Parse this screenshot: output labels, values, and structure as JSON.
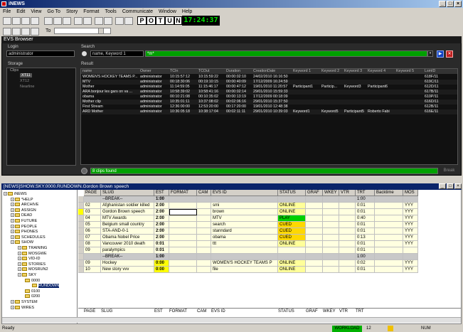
{
  "window": {
    "title": "iNEWS",
    "minimize": "_",
    "maximize": "□",
    "close": "×"
  },
  "menu": [
    "File",
    "Edit",
    "View",
    "Go To",
    "Story",
    "Format",
    "Tools",
    "Communicate",
    "Window",
    "Help"
  ],
  "toolbar": {
    "letters": [
      "P",
      "O",
      "T",
      "U",
      "N"
    ],
    "clock": "17:24:37",
    "to_label": "To"
  },
  "evs": {
    "title": "EVS Browser",
    "login_label": "Login",
    "login_value": "administrator",
    "search_label": "Search",
    "search_placeholder": "name, Keyword 1",
    "search_query": "*m*",
    "storage_label": "Storage",
    "storage_items": [
      "Clips",
      "XT11",
      "XT12",
      "Nearline"
    ],
    "result_label": "Result",
    "status": "8 clips found",
    "break_label": "Break",
    "columns": [
      "name",
      "Owner",
      "TCIn",
      "TCOut",
      "Duration",
      "CreationDate",
      "Keyword 1",
      "Keyword 2",
      "Keyword 3",
      "Keyword 4",
      "Keyword 5",
      "LsmID"
    ],
    "rows": [
      [
        "WOMEN'S HOCKEY TEAMS P...",
        "administrator",
        "10:15:57:12",
        "10:15:59:22",
        "00:00:02:10",
        "24/02/2010 16:16:50",
        "",
        "",
        "",
        "",
        "",
        "618F/11"
      ],
      [
        "MTV",
        "administrator",
        "00:18:30:06",
        "00:19:10:15",
        "00:00:40:09",
        "17/12/2009 16:24:59",
        "",
        "",
        "",
        "",
        "",
        "619C/11"
      ],
      [
        "Mother",
        "administrator",
        "11:14:59:05",
        "11:15:46:17",
        "00:00:47:12",
        "19/01/2010 11:20:57",
        "Participant1",
        "Particip...",
        "Keyword3",
        "Participant6",
        "",
        "612D/11"
      ],
      [
        "ARA bonjour les gars on va ...",
        "administrator",
        "10:58:39:02",
        "10:58:41:16",
        "00:00:02:14",
        "29/01/2010 15:59:33",
        "",
        "",
        "",
        "",
        "",
        "617B/11"
      ],
      [
        "obama",
        "administrator",
        "00:10:21:08",
        "00:10:35:02",
        "00:00:13:19",
        "17/12/2009 00:18:09",
        "",
        "",
        "",
        "",
        "",
        "610P/11"
      ],
      [
        "Mother clip",
        "administrator",
        "10:35:01:11",
        "10:37:08:02",
        "00:02:06:16",
        "29/01/2010 15:37:50",
        "",
        "",
        "",
        "",
        "",
        "616D/11"
      ],
      [
        "First Stream",
        "administrator",
        "12:36:00:00",
        "12:53:20:00",
        "00:17:20:00",
        "19/01/2010 12:48:38",
        "",
        "",
        "",
        "",
        "",
        "612B/11"
      ],
      [
        "ARD Mother",
        "administrator",
        "10:36:05:18",
        "10:38:17:04",
        "00:02:11:11",
        "29/01/2010 10:39:03",
        "Keyword1",
        "Keyword5",
        "Participant5",
        "Roberto Fabi",
        "",
        "616E/11"
      ]
    ]
  },
  "rundown": {
    "title": "[NEWS]SHOW.SKY.0000.RUNDOWN.Gordon Brown speech",
    "tree": [
      {
        "label": "iNEWS",
        "level": 0
      },
      {
        "label": "*HELP",
        "level": 1
      },
      {
        "label": "ARCHIVE",
        "level": 1
      },
      {
        "label": "ASSIGN",
        "level": 1
      },
      {
        "label": "DEAD",
        "level": 1
      },
      {
        "label": "FUTURE",
        "level": 1
      },
      {
        "label": "PEOPLE",
        "level": 1
      },
      {
        "label": "PHONES",
        "level": 1
      },
      {
        "label": "SCHEDULES",
        "level": 1
      },
      {
        "label": "SHOW",
        "level": 1
      },
      {
        "label": "TRAINING",
        "level": 2
      },
      {
        "label": "MOSGWE",
        "level": 2
      },
      {
        "label": "VID-ID",
        "level": 2
      },
      {
        "label": "STORIES",
        "level": 2
      },
      {
        "label": "MOSRUN2",
        "level": 2
      },
      {
        "label": "SKY",
        "level": 2
      },
      {
        "label": "0000",
        "level": 3
      },
      {
        "label": "RUNDOWN",
        "level": 4
      },
      {
        "label": "0100",
        "level": 3
      },
      {
        "label": "0200",
        "level": 3
      },
      {
        "label": "SYSTEM",
        "level": 1
      },
      {
        "label": "WIRES",
        "level": 1
      }
    ],
    "columns": [
      "PAGE",
      "SLUG",
      "EST",
      "FORMAT",
      "CAM",
      "EVS ID",
      "STATUS",
      "GRAF",
      "WKEY",
      "VTR",
      "TRT",
      "Backtime",
      "MOS"
    ],
    "rows": [
      [
        "",
        "--BREAK--",
        "1:00",
        "",
        "",
        "",
        "",
        "",
        "",
        "",
        "1:00",
        "",
        ""
      ],
      [
        "02",
        "Afghanistan soldier killed",
        "2:00",
        "",
        "",
        "smi",
        "ONLINE",
        "",
        "",
        "",
        "0:01",
        "",
        "YYY"
      ],
      [
        "03",
        "Gordon Brown speech",
        "2:00",
        "",
        "",
        "brown",
        "ONLINE",
        "",
        "",
        "",
        "0:01",
        "",
        "YYY"
      ],
      [
        "04",
        "MTV Awards",
        "2:00",
        "",
        "",
        "MTV",
        "PLAY",
        "",
        "",
        "",
        "0:40",
        "",
        "YYY"
      ],
      [
        "05",
        "Belgium small country",
        "2:00",
        "",
        "",
        "search",
        "CUED",
        "",
        "",
        "",
        "0:01",
        "",
        "YYY"
      ],
      [
        "06",
        "STA-AND-0-1",
        "2:00",
        "",
        "",
        "stanndard",
        "CUED",
        "",
        "",
        "",
        "0:01",
        "",
        "YYY"
      ],
      [
        "07",
        "Obama Nobel Price",
        "2:00",
        "",
        "",
        "obama",
        "CUED",
        "",
        "",
        "",
        "0:13",
        "",
        "YYY"
      ],
      [
        "08",
        "Vancouver 2010 death",
        "0:01",
        "",
        "",
        "ttt",
        "ONLINE",
        "",
        "",
        "",
        "0:01",
        "",
        "YYY"
      ],
      [
        "09",
        "paralympics",
        "0:01",
        "",
        "",
        "",
        "",
        "",
        "",
        "",
        "0:01",
        "",
        ""
      ],
      [
        "",
        "--BREAK--",
        "1:00",
        "",
        "",
        "",
        "",
        "",
        "",
        "",
        "1:00",
        "",
        ""
      ],
      [
        "09",
        "Hockey",
        "0:00",
        "",
        "",
        "WOMEN'S HOCKEY TEAMS P",
        "ONLINE",
        "",
        "",
        "",
        "0:02",
        "",
        "YYY"
      ],
      [
        "10",
        "New story vvv",
        "0:00",
        "",
        "",
        "file",
        "ONLINE",
        "",
        "",
        "",
        "0:01",
        "",
        "YYY"
      ]
    ],
    "footer_columns": [
      "PAGE",
      "SLUG",
      "EST",
      "FORMAT",
      "CAM",
      "EVS ID",
      "STATUS",
      "GRAF",
      "WKEY",
      "VTR",
      "TRT"
    ]
  },
  "statusbar": {
    "left": "Ready",
    "workload": "WORKLOAD",
    "count": "12",
    "mode": "NUM"
  }
}
